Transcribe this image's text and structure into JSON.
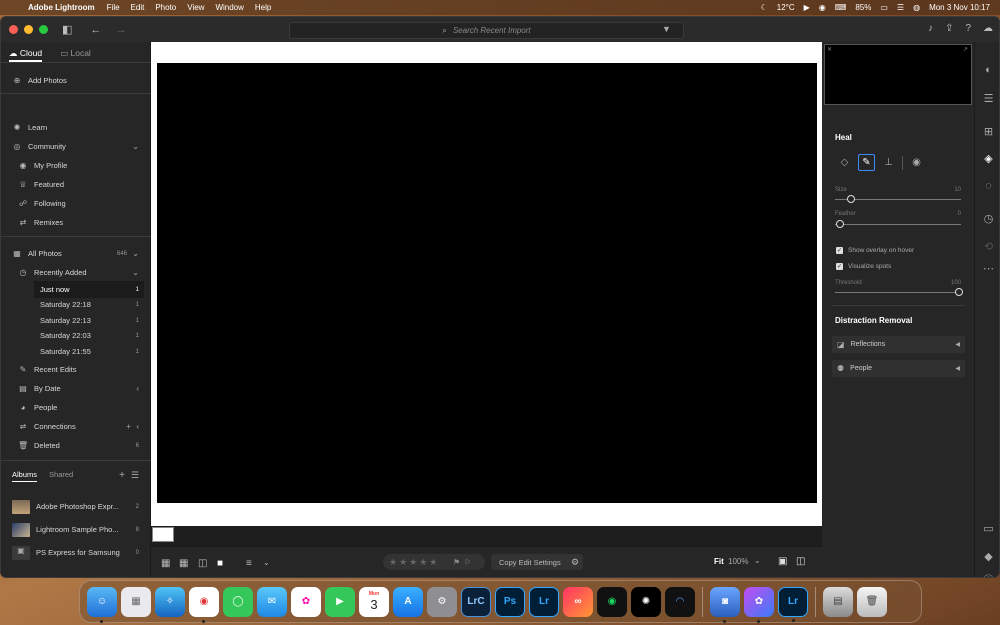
{
  "menubar": {
    "app_name": "Adobe Lightroom",
    "menus": [
      "File",
      "Edit",
      "Photo",
      "View",
      "Window",
      "Help"
    ],
    "temperature": "12°C",
    "battery": "85%",
    "datetime": "Mon 3 Nov  10:17"
  },
  "toolbar": {
    "search_placeholder": "Search Recent Import"
  },
  "left_panel": {
    "tabs": [
      "Cloud",
      "Local"
    ],
    "add_photos": "Add Photos",
    "learn": "Learn",
    "community": "Community",
    "community_items": [
      "My Profile",
      "Featured",
      "Following",
      "Remixes"
    ],
    "all_photos": "All Photos",
    "all_photos_count": "646",
    "recently_added": "Recently Added",
    "recent_imports": [
      {
        "label": "Just now",
        "count": "1"
      },
      {
        "label": "Saturday  22:18",
        "count": "1"
      },
      {
        "label": "Saturday  22:13",
        "count": "1"
      },
      {
        "label": "Saturday  22:03",
        "count": "1"
      },
      {
        "label": "Saturday  21:55",
        "count": "1"
      }
    ],
    "recent_edits": "Recent Edits",
    "by_date": "By Date",
    "people": "People",
    "connections": "Connections",
    "deleted": "Deleted",
    "deleted_count": "6",
    "album_tabs": [
      "Albums",
      "Shared"
    ],
    "albums": [
      {
        "name": "Adobe Photoshop Expr...",
        "count": "2"
      },
      {
        "name": "Lightroom Sample Pho...",
        "count": "8"
      },
      {
        "name": "PS Express for Samsung",
        "count": "0"
      }
    ]
  },
  "bottom_bar": {
    "stars": "★★★★★",
    "copy_edit_settings": "Copy Edit Settings",
    "zoom_mode": "Fit",
    "zoom_percent": "100%"
  },
  "right_panel": {
    "heal_title": "Heal",
    "size_label": "Size",
    "size_value": "10",
    "feather_label": "Feather",
    "feather_value": "0",
    "show_overlay": "Show overlay on hover",
    "visualize_spots": "Visualize spots",
    "threshold_label": "Threshold",
    "threshold_value": "100",
    "distraction_title": "Distraction Removal",
    "reflections": "Reflections",
    "people_item": "People"
  },
  "dock": {
    "calendar_month": "Mon",
    "calendar_day": "3",
    "apps": [
      "Finder",
      "Launchpad",
      "Safari",
      "Chrome",
      "Messages",
      "Mail",
      "Photos",
      "FaceTime",
      "Calendar",
      "App Store",
      "System Settings",
      "LrC",
      "Ps",
      "Lr",
      "Creative Cloud",
      "Spotify",
      "ChatGPT",
      "Arc",
      "Preview",
      "Photoshop Express",
      "Lightroom",
      "Downloads",
      "Trash"
    ]
  }
}
